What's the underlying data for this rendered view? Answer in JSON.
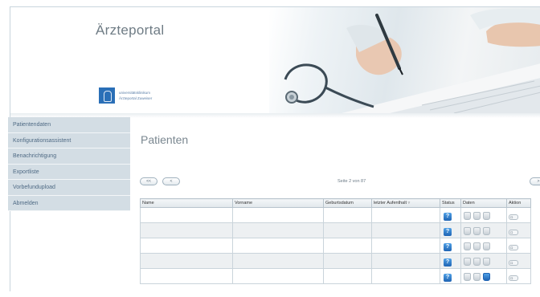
{
  "header": {
    "title": "Ärzteportal",
    "logo_line1": "universitätsklinikum",
    "logo_line2": "Ärzteportal Zuweiser"
  },
  "sidebar": {
    "items": [
      {
        "label": "Patientendaten"
      },
      {
        "label": "Konfigurationsassistent"
      },
      {
        "label": "Benachrichtigung"
      },
      {
        "label": "Exportliste"
      },
      {
        "label": "Vorbefundupload"
      },
      {
        "label": "Abmelden"
      }
    ]
  },
  "main": {
    "title": "Patienten",
    "pager": {
      "first_label": "<<",
      "prev_label": "<",
      "text": "Seite 2 von 87",
      "next_label": ">"
    },
    "table": {
      "columns": {
        "name": "Name",
        "vorname": "Vorname",
        "geburtsdatum": "Geburtsdatum",
        "letzter_aufenthalt": "letzter Aufenthalt",
        "sort_icon": "filter-icon",
        "status": "Status",
        "daten": "Daten",
        "aktion": "Aktion"
      },
      "status_glyph": "?",
      "action_glyph": "Ω",
      "rows": [
        {
          "name": "",
          "vorname": "",
          "geburtsdatum": "",
          "letzter_aufenthalt": "",
          "status": "info",
          "daten": [
            "inactive",
            "inactive",
            "inactive"
          ]
        },
        {
          "name": "",
          "vorname": "",
          "geburtsdatum": "",
          "letzter_aufenthalt": "",
          "status": "info",
          "daten": [
            "inactive",
            "inactive",
            "inactive"
          ]
        },
        {
          "name": "",
          "vorname": "",
          "geburtsdatum": "",
          "letzter_aufenthalt": "",
          "status": "info",
          "daten": [
            "inactive",
            "inactive",
            "inactive"
          ]
        },
        {
          "name": "",
          "vorname": "",
          "geburtsdatum": "",
          "letzter_aufenthalt": "",
          "status": "info",
          "daten": [
            "inactive",
            "inactive",
            "inactive"
          ]
        },
        {
          "name": "",
          "vorname": "",
          "geburtsdatum": "",
          "letzter_aufenthalt": "",
          "status": "info",
          "daten": [
            "inactive",
            "inactive",
            "active"
          ]
        }
      ]
    }
  },
  "colors": {
    "sidebar_bg": "#d3dde4",
    "sidebar_text": "#4f6a84",
    "status_blue": "#2a7bd0",
    "header_title": "#6f7c85"
  }
}
